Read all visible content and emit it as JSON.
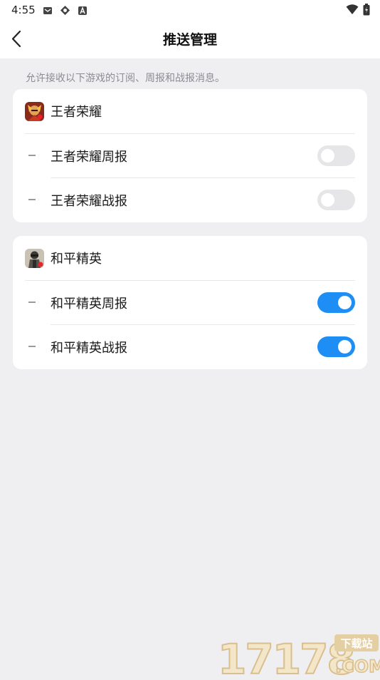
{
  "status_bar": {
    "time": "4:55",
    "icons": [
      "mail-icon",
      "sync-icon",
      "a-badge-icon"
    ],
    "right_icons": [
      "wifi-icon",
      "battery-icon"
    ]
  },
  "header": {
    "back_icon": "chevron-left-icon",
    "title": "推送管理"
  },
  "hint": "允许接收以下游戏的订阅、周报和战报消息。",
  "games": [
    {
      "name": "王者荣耀",
      "icon": "honor-of-kings-icon",
      "items": [
        {
          "label": "王者荣耀周报",
          "enabled": false
        },
        {
          "label": "王者荣耀战报",
          "enabled": false
        }
      ]
    },
    {
      "name": "和平精英",
      "icon": "game-for-peace-icon",
      "items": [
        {
          "label": "和平精英周报",
          "enabled": true
        },
        {
          "label": "和平精英战报",
          "enabled": true
        }
      ]
    }
  ],
  "colors": {
    "accent": "#1e8ef5",
    "toggle_off": "#e6e6e9",
    "background": "#efeff2"
  },
  "watermark": {
    "number": "17178",
    "tag": "下载站",
    "domain": ".COM"
  }
}
